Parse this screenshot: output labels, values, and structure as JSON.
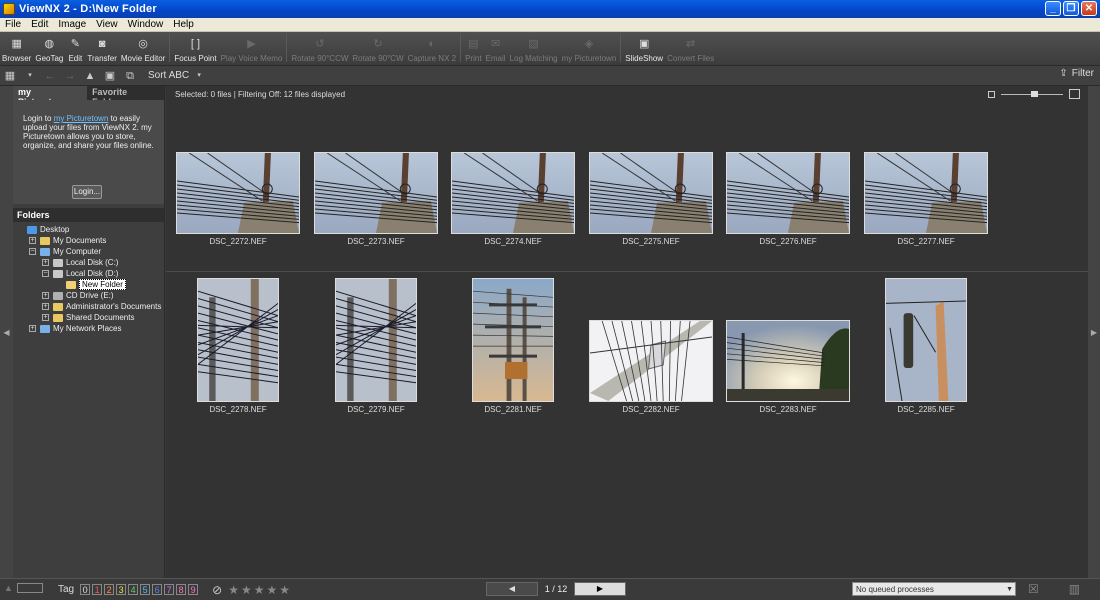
{
  "window": {
    "title": "ViewNX 2 - D:\\New Folder"
  },
  "menu": [
    "File",
    "Edit",
    "Image",
    "View",
    "Window",
    "Help"
  ],
  "toolbar": [
    {
      "label": "Browser",
      "icon": "browser-icon",
      "glyph": "▦",
      "enabled": true
    },
    {
      "label": "GeoTag",
      "icon": "globe-icon",
      "glyph": "◍",
      "enabled": true
    },
    {
      "label": "Edit",
      "icon": "edit-icon",
      "glyph": "✎",
      "enabled": true
    },
    {
      "label": "Transfer",
      "icon": "camera-icon",
      "glyph": "◙",
      "enabled": true
    },
    {
      "label": "Movie Editor",
      "icon": "film-reel-icon",
      "glyph": "◎",
      "enabled": true
    },
    {
      "label": "Focus Point",
      "icon": "focus-point-icon",
      "glyph": "[ ]",
      "enabled": true
    },
    {
      "label": "Play Voice Memo",
      "icon": "play-icon",
      "glyph": "▶",
      "enabled": false
    },
    {
      "label": "Rotate 90°CCW",
      "icon": "rotate-ccw-icon",
      "glyph": "↺",
      "enabled": false
    },
    {
      "label": "Rotate 90°CW",
      "icon": "rotate-cw-icon",
      "glyph": "↻",
      "enabled": false
    },
    {
      "label": "Capture NX 2",
      "icon": "capture-icon",
      "glyph": "◐",
      "enabled": false
    },
    {
      "label": "Print",
      "icon": "print-icon",
      "glyph": "▤",
      "enabled": false
    },
    {
      "label": "Email",
      "icon": "email-icon",
      "glyph": "✉",
      "enabled": false
    },
    {
      "label": "Log Matching",
      "icon": "log-matching-icon",
      "glyph": "▧",
      "enabled": false
    },
    {
      "label": "my Picturetown",
      "icon": "picturetown-icon",
      "glyph": "◈",
      "enabled": false
    },
    {
      "label": "SlideShow",
      "icon": "slideshow-icon",
      "glyph": "▣",
      "enabled": true
    },
    {
      "label": "Convert Files",
      "icon": "convert-icon",
      "glyph": "⇄",
      "enabled": false
    }
  ],
  "toolbar2": {
    "sort_label": "Sort ABC",
    "filter_label": "Filter"
  },
  "left_panel": {
    "tabs": [
      "my Picturetown",
      "Favorite Folders"
    ],
    "picturetown_text_pre": "Login to ",
    "picturetown_link": "my Picturetown",
    "picturetown_text_post": " to easily upload your files from ViewNX 2. my Picturetown allows you to store, organize, and share your files online.",
    "login_button": "Login...",
    "folders_header": "Folders",
    "tree": [
      {
        "label": "Desktop",
        "indent": 0,
        "exp": "",
        "icon": "desktop-icon",
        "color": "#4a9ae8"
      },
      {
        "label": "My Documents",
        "indent": 1,
        "exp": "+",
        "icon": "folder-icon",
        "color": "#e8c860"
      },
      {
        "label": "My Computer",
        "indent": 1,
        "exp": "−",
        "icon": "computer-icon",
        "color": "#7ab0e8"
      },
      {
        "label": "Local Disk (C:)",
        "indent": 2,
        "exp": "+",
        "icon": "drive-icon",
        "color": "#c8c8c8"
      },
      {
        "label": "Local Disk (D:)",
        "indent": 2,
        "exp": "−",
        "icon": "drive-icon",
        "color": "#c8c8c8"
      },
      {
        "label": "New Folder",
        "indent": 3,
        "exp": "",
        "icon": "folder-icon",
        "color": "#f0d070",
        "selected": true
      },
      {
        "label": "CD Drive (E:)",
        "indent": 2,
        "exp": "+",
        "icon": "cd-drive-icon",
        "color": "#b0b0b0"
      },
      {
        "label": "Administrator's Documents",
        "indent": 2,
        "exp": "+",
        "icon": "folder-icon",
        "color": "#e8c860"
      },
      {
        "label": "Shared Documents",
        "indent": 2,
        "exp": "+",
        "icon": "folder-icon",
        "color": "#e8c860"
      },
      {
        "label": "My Network Places",
        "indent": 1,
        "exp": "+",
        "icon": "network-icon",
        "color": "#7ab0e8"
      }
    ]
  },
  "main": {
    "status": "Selected: 0 files | Filtering Off: 12 files displayed",
    "thumbnails": [
      {
        "name": "DSC_2272.NEF",
        "orientation": "landscape",
        "scene": "pole-up"
      },
      {
        "name": "DSC_2273.NEF",
        "orientation": "landscape",
        "scene": "pole-up"
      },
      {
        "name": "DSC_2274.NEF",
        "orientation": "landscape",
        "scene": "pole-up"
      },
      {
        "name": "DSC_2275.NEF",
        "orientation": "landscape",
        "scene": "pole-up"
      },
      {
        "name": "DSC_2276.NEF",
        "orientation": "landscape",
        "scene": "pole-up"
      },
      {
        "name": "DSC_2277.NEF",
        "orientation": "landscape",
        "scene": "pole-up"
      },
      {
        "name": "DSC_2278.NEF",
        "orientation": "portrait",
        "scene": "wires"
      },
      {
        "name": "DSC_2279.NEF",
        "orientation": "portrait",
        "scene": "wires"
      },
      {
        "name": "DSC_2281.NEF",
        "orientation": "portrait",
        "scene": "transformer"
      },
      {
        "name": "DSC_2282.NEF",
        "orientation": "landscape",
        "scene": "bright-diagonal"
      },
      {
        "name": "DSC_2283.NEF",
        "orientation": "landscape",
        "scene": "sunset"
      },
      {
        "name": "DSC_2285.NEF",
        "orientation": "portrait",
        "scene": "lamp"
      }
    ]
  },
  "bottom": {
    "tag_label": "Tag",
    "tags": [
      {
        "n": "0",
        "color": "#dddddd"
      },
      {
        "n": "1",
        "color": "#ff5050"
      },
      {
        "n": "2",
        "color": "#ff9040"
      },
      {
        "n": "3",
        "color": "#e8e050"
      },
      {
        "n": "4",
        "color": "#60d060"
      },
      {
        "n": "5",
        "color": "#50c0ff"
      },
      {
        "n": "6",
        "color": "#6080ff"
      },
      {
        "n": "7",
        "color": "#d070ff"
      },
      {
        "n": "8",
        "color": "#ff70c0"
      },
      {
        "n": "9",
        "color": "#ff70c0"
      }
    ],
    "stars": 5,
    "page": "1 / 12",
    "queue": "No queued processes"
  }
}
